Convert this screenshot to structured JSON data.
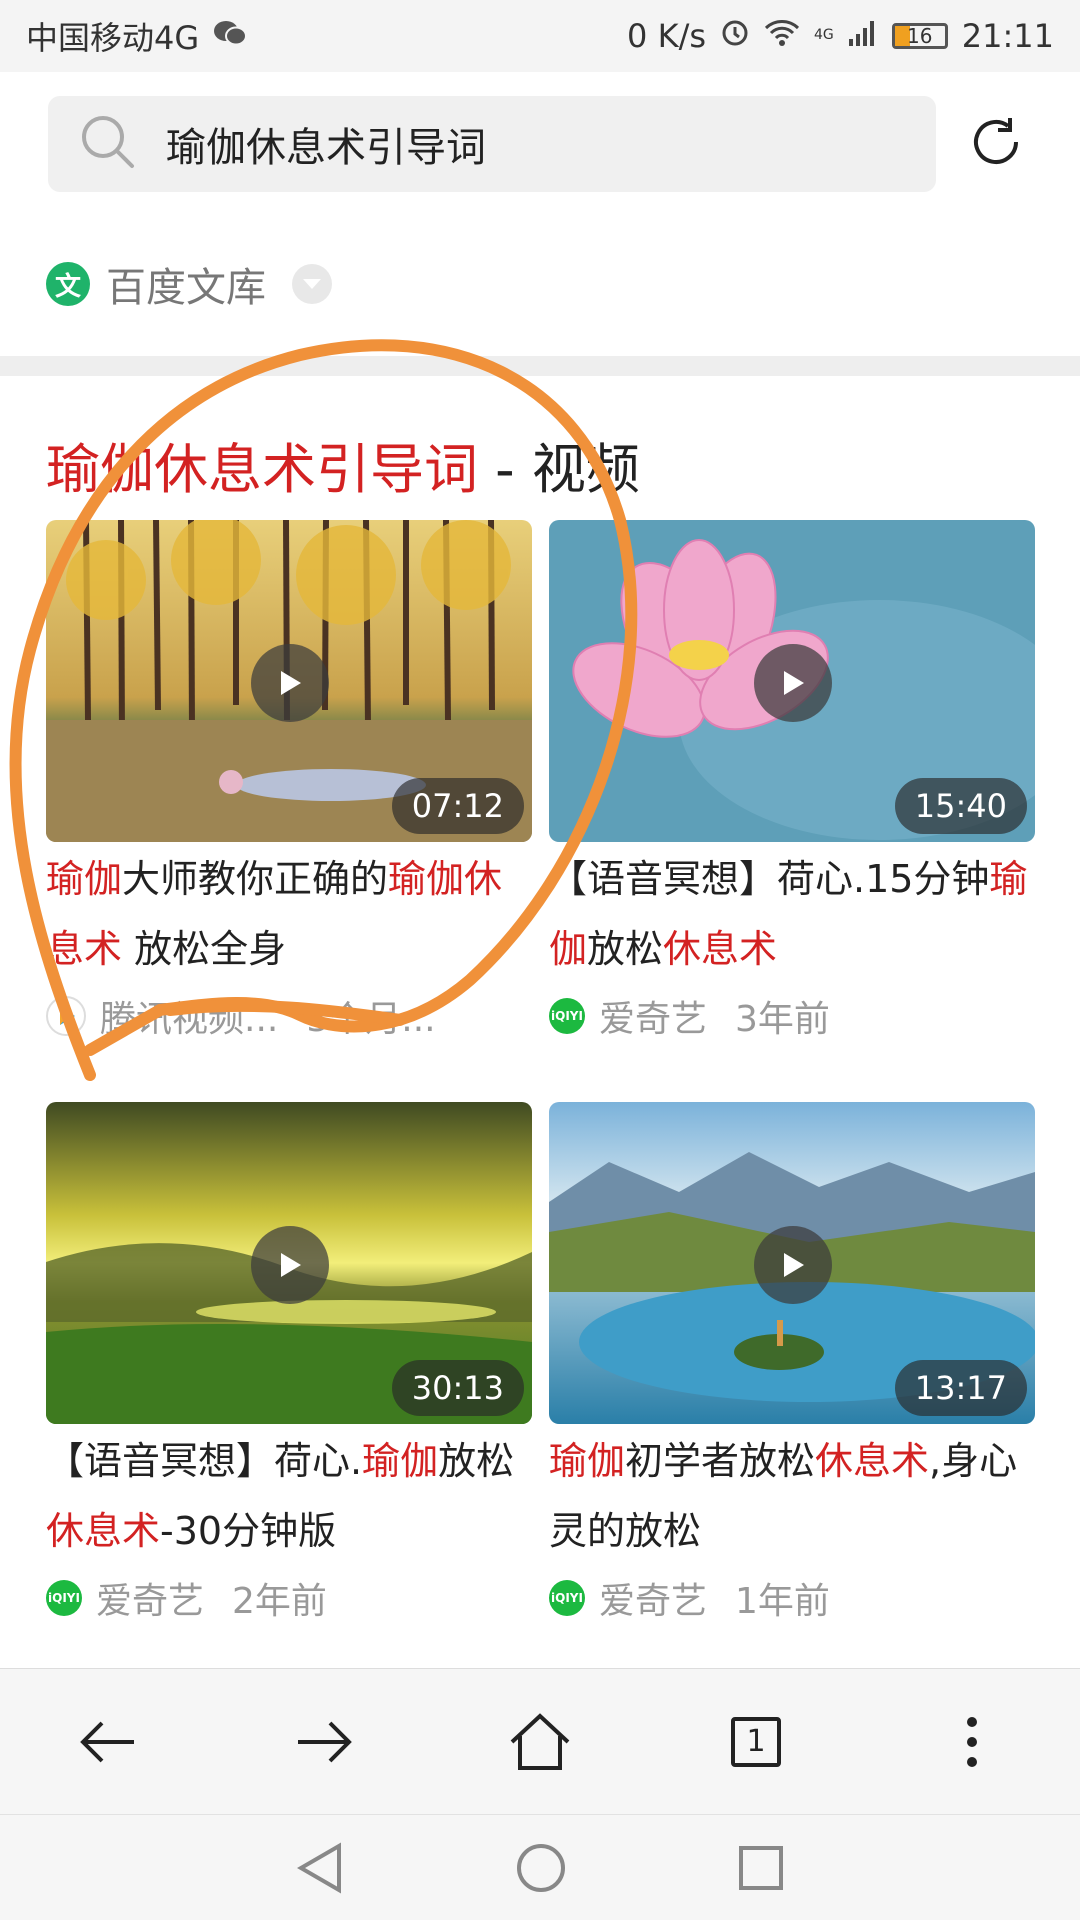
{
  "status": {
    "carrier": "中国移动4G",
    "speed": "0 K/s",
    "network": "4G",
    "battery": "16",
    "time": "21:11"
  },
  "search": {
    "query": "瑜伽休息术引导词"
  },
  "source": {
    "badge": "文",
    "label": "百度文库"
  },
  "section": {
    "title_highlight": "瑜伽休息术引导词",
    "title_rest": " - 视频"
  },
  "videos": [
    {
      "duration": "07:12",
      "title_parts": [
        {
          "t": "瑜伽",
          "hl": true
        },
        {
          "t": "大师教你正确的",
          "hl": false
        },
        {
          "t": "瑜伽",
          "hl": true
        },
        {
          "t": "休息术",
          "hl": true
        },
        {
          "t": " 放松全身",
          "hl": false
        }
      ],
      "source": "腾讯视频...",
      "time": "3个月..."
    },
    {
      "duration": "15:40",
      "title_parts": [
        {
          "t": "【语音冥想】荷心.15分钟",
          "hl": false
        },
        {
          "t": "瑜伽",
          "hl": true
        },
        {
          "t": "放松",
          "hl": false
        },
        {
          "t": "休息术",
          "hl": true
        }
      ],
      "source": "爱奇艺",
      "time": "3年前"
    },
    {
      "duration": "30:13",
      "title_parts": [
        {
          "t": "【语音冥想】荷心.",
          "hl": false
        },
        {
          "t": "瑜伽",
          "hl": true
        },
        {
          "t": "放松",
          "hl": false
        },
        {
          "t": "休息术",
          "hl": true
        },
        {
          "t": "-30分钟版",
          "hl": false
        }
      ],
      "source": "爱奇艺",
      "time": "2年前"
    },
    {
      "duration": "13:17",
      "title_parts": [
        {
          "t": "瑜伽",
          "hl": true
        },
        {
          "t": "初学者放松",
          "hl": false
        },
        {
          "t": "休息术",
          "hl": true
        },
        {
          "t": ",身心灵的放松",
          "hl": false
        }
      ],
      "source": "爱奇艺",
      "time": "1年前"
    }
  ],
  "bottom_nav": {
    "tab_count": "1"
  },
  "colors": {
    "highlight": "#d32222",
    "annotation": "#f0913a",
    "iqiyi": "#1cb940"
  }
}
